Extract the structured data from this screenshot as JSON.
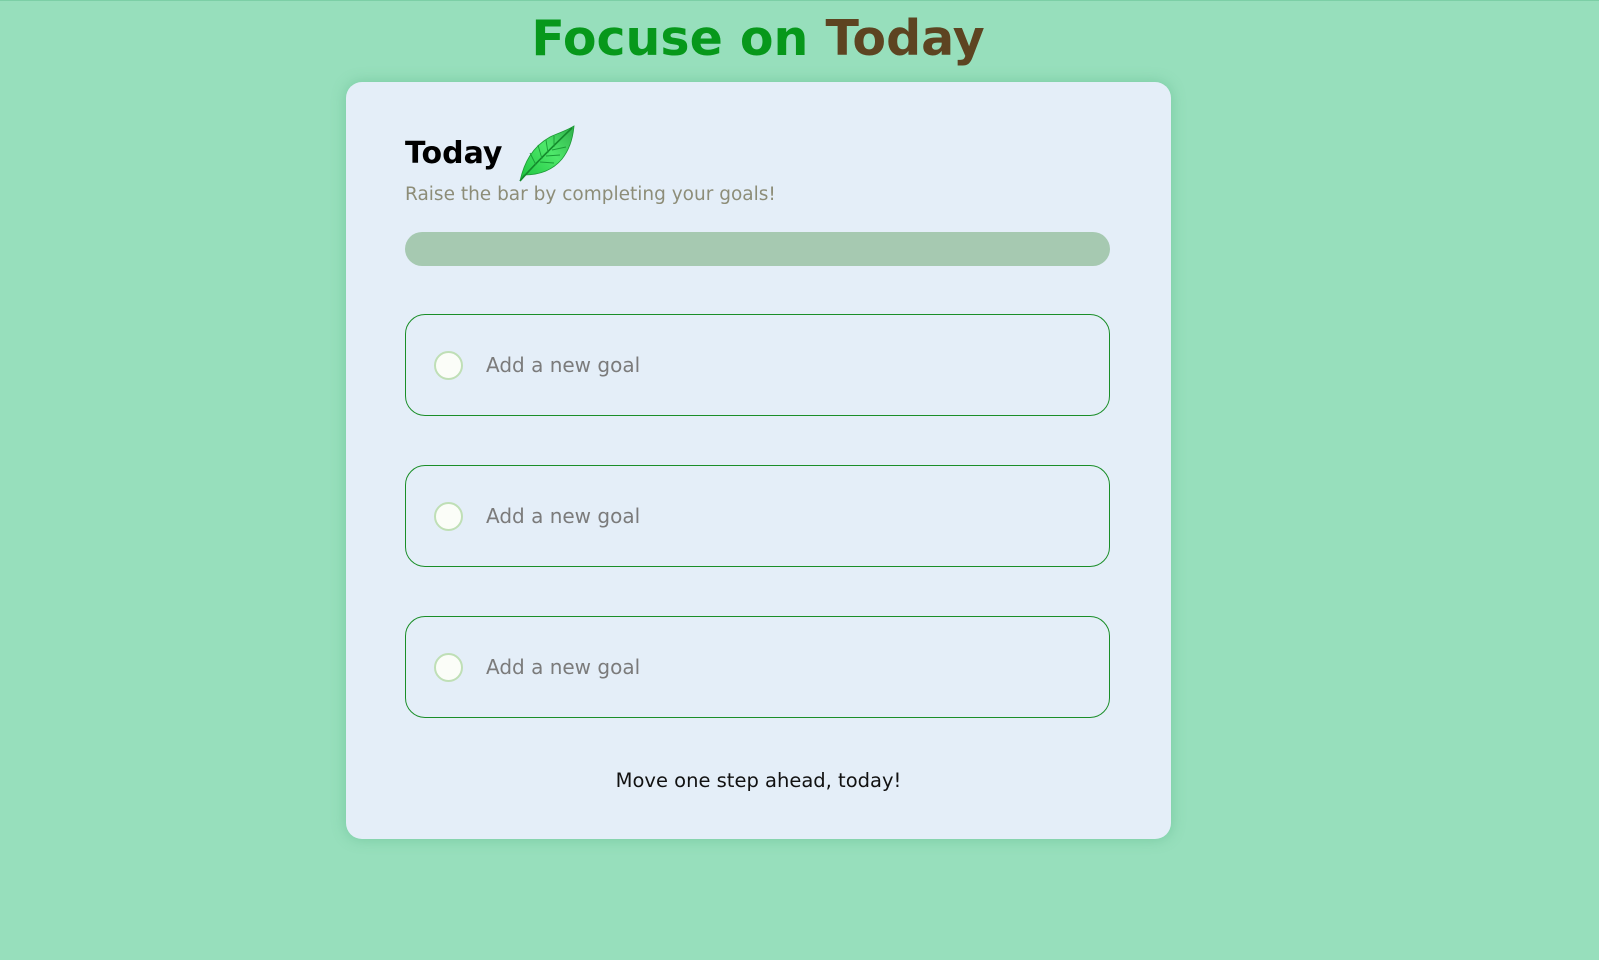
{
  "app": {
    "title_part1": "Focuse on",
    "title_part2": "Today"
  },
  "colors": {
    "background": "#97dfbc",
    "card": "#e4eef8",
    "title_green": "#07981b",
    "title_brown": "#5d4421",
    "progress_track": "#a6c9b1",
    "goal_border": "#1a8e28"
  },
  "card": {
    "title": "Today",
    "icon": "leaf-icon",
    "subtitle": "Raise the bar by completing your goals!",
    "progress": {
      "completed": 0,
      "total": 3,
      "fraction": 0
    },
    "goals": [
      {
        "placeholder": "Add a new goal",
        "value": "",
        "checked": false
      },
      {
        "placeholder": "Add a new goal",
        "value": "",
        "checked": false
      },
      {
        "placeholder": "Add a new goal",
        "value": "",
        "checked": false
      }
    ],
    "quote": "Move one step ahead, today!"
  }
}
